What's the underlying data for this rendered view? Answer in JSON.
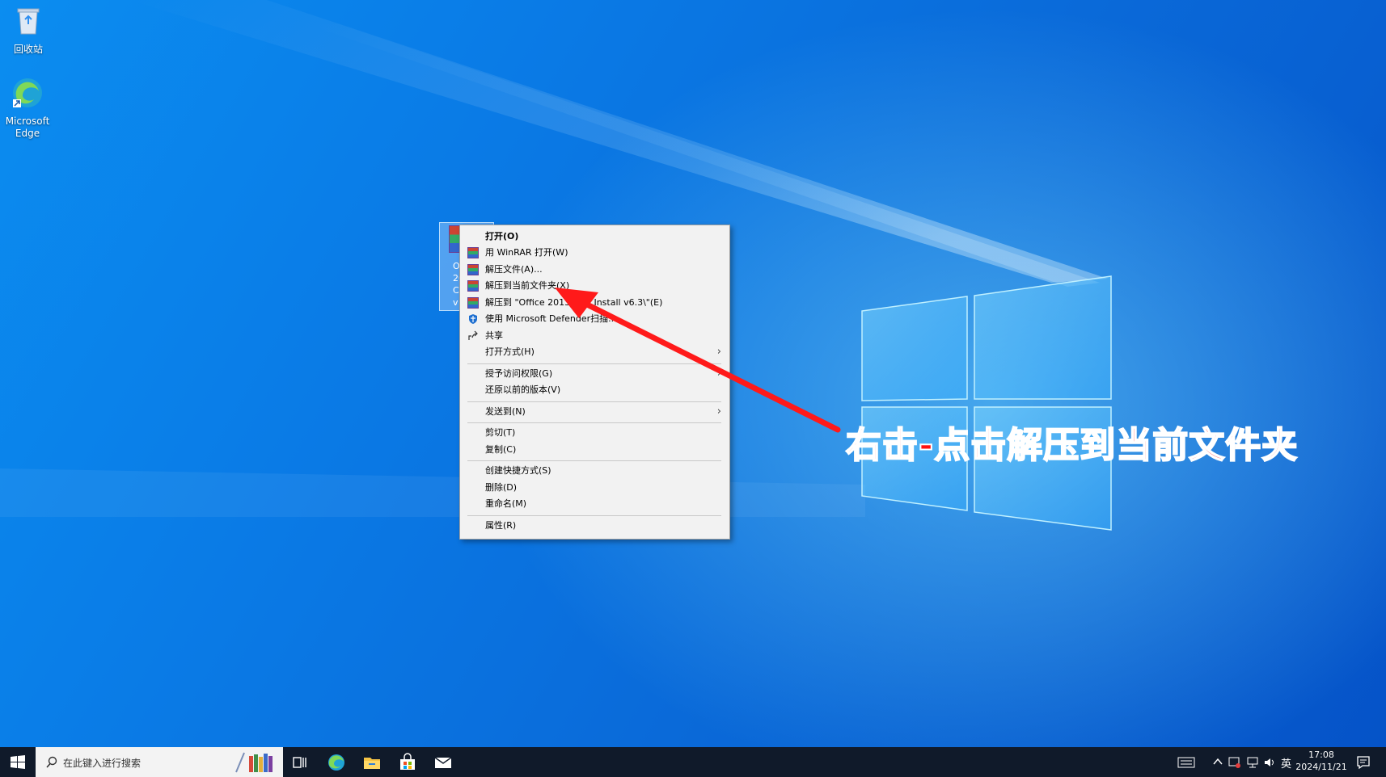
{
  "desktop": {
    "icons": [
      {
        "label": "回收站"
      },
      {
        "label": "Microsoft Edge"
      }
    ],
    "selected_file": {
      "label_lines": [
        "O",
        "201",
        "C2R",
        "v"
      ]
    }
  },
  "context_menu": {
    "items": [
      {
        "label": "打开(O)",
        "icon": "none",
        "bold": true
      },
      {
        "label": "用 WinRAR 打开(W)",
        "icon": "winrar-icon"
      },
      {
        "label": "解压文件(A)...",
        "icon": "winrar-icon"
      },
      {
        "label": "解压到当前文件夹(X)",
        "icon": "winrar-icon"
      },
      {
        "label": "解压到 \"Office 2013 C2R Install v6.3\\\"(E)",
        "icon": "winrar-icon"
      },
      {
        "label": "使用 Microsoft Defender扫描...",
        "icon": "defender-shield-icon"
      },
      {
        "label": "共享",
        "icon": "share-icon"
      },
      {
        "label": "打开方式(H)",
        "icon": "none",
        "submenu": true
      },
      {
        "label": "授予访问权限(G)",
        "icon": "none",
        "submenu": true
      },
      {
        "label": "还原以前的版本(V)",
        "icon": "none"
      },
      {
        "label": "发送到(N)",
        "icon": "none",
        "submenu": true
      },
      {
        "label": "剪切(T)",
        "icon": "none"
      },
      {
        "label": "复制(C)",
        "icon": "none"
      },
      {
        "label": "创建快捷方式(S)",
        "icon": "none"
      },
      {
        "label": "删除(D)",
        "icon": "none"
      },
      {
        "label": "重命名(M)",
        "icon": "none"
      },
      {
        "label": "属性(R)",
        "icon": "none"
      }
    ]
  },
  "annotation": {
    "text": "右击-点击解压到当前文件夹",
    "color": "#ff1010"
  },
  "taskbar": {
    "search_placeholder": "在此键入进行搜索",
    "tray": {
      "ime": "英",
      "time": "17:08",
      "date": "2024/11/21"
    }
  },
  "colors": {
    "desktop_blue": "#0a7be6",
    "taskbar": "#101a2a",
    "menu_bg": "#f2f2f2"
  }
}
